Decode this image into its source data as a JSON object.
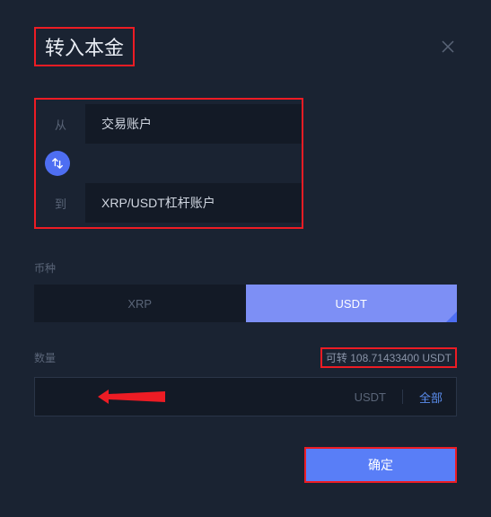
{
  "modal": {
    "title": "转入本金"
  },
  "transfer": {
    "from_label": "从",
    "from_value": "交易账户",
    "to_label": "到",
    "to_value": "XRP/USDT杠杆账户"
  },
  "currency": {
    "label": "币种",
    "tabs": {
      "xrp": "XRP",
      "usdt": "USDT"
    }
  },
  "amount": {
    "label": "数量",
    "available": "可转 108.71433400 USDT",
    "suffix_currency": "USDT",
    "all_btn": "全部"
  },
  "actions": {
    "confirm": "确定"
  }
}
